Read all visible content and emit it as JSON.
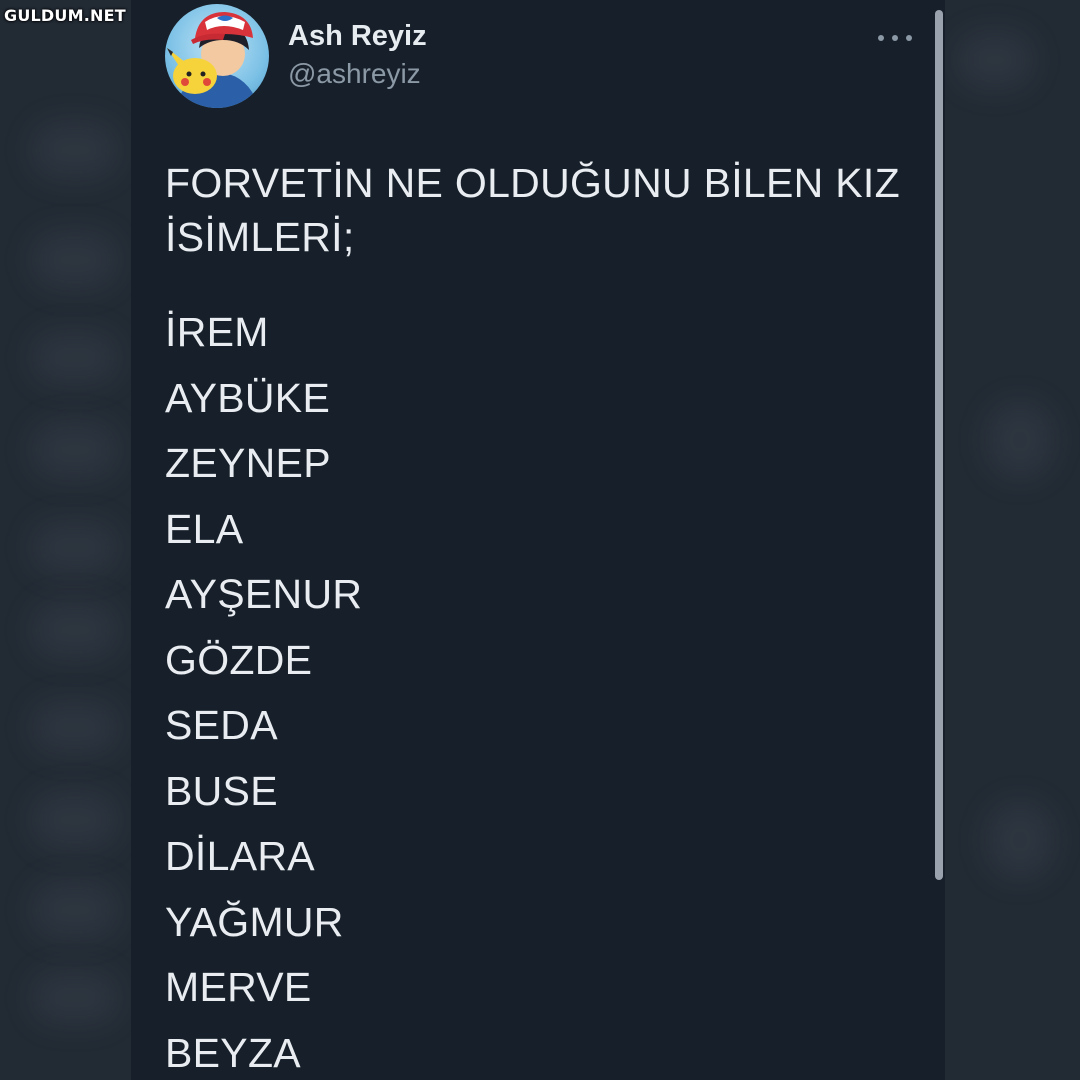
{
  "watermark": "GULDUM.NET",
  "tweet": {
    "author_name": "Ash Reyiz",
    "author_handle": "@ashreyiz",
    "avatar_icon": "ash-pikachu-avatar-icon",
    "more_icon": "more-horizontal-icon",
    "title": "FORVETİN NE OLDUĞUNU BİLEN KIZ İSİMLERİ;",
    "names": [
      "İREM",
      "AYBÜKE",
      "ZEYNEP",
      "ELA",
      "AYŞENUR",
      "GÖZDE",
      "SEDA",
      "BUSE",
      "DİLARA",
      "YAĞMUR",
      "MERVE",
      "BEYZA"
    ]
  },
  "colors": {
    "background": "#17202a",
    "text_primary": "#e9edf1",
    "text_secondary": "#8b98a5"
  }
}
